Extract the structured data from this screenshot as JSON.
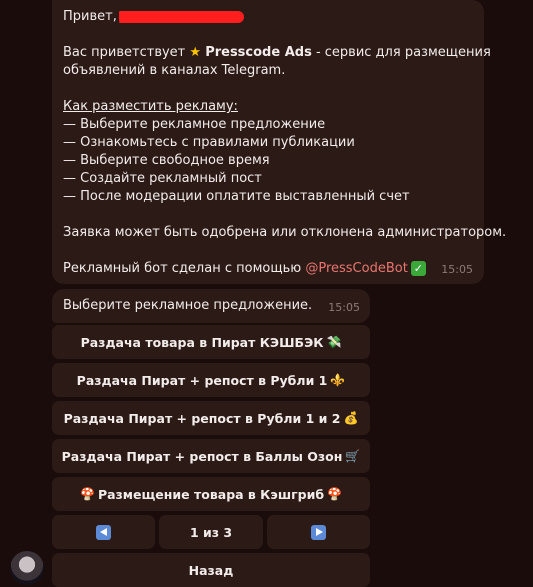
{
  "message1": {
    "greeting": "Привет,",
    "intro_prefix": "Вас приветствует",
    "intro_brand": "Presscode Ads",
    "intro_suffix": "- сервис для размещения",
    "intro_line2": "объявлений в каналах Telegram.",
    "howto_title": "Как разместить рекламу:",
    "steps": [
      "— Выберите рекламное предложение",
      "— Ознакомьтесь с правилами публикации",
      "— Выберите свободное время",
      "— Создайте рекламный пост",
      "— После модерации оплатите выставленный счет"
    ],
    "approval_note": "Заявка может быть одобрена или отклонена администратором.",
    "made_with": "Рекламный бот сделан с помощью",
    "mention": "@PressCodeBot",
    "time": "15:05"
  },
  "message2": {
    "text": "Выберите рекламное предложение.",
    "time": "15:05"
  },
  "keyboard": {
    "buttons": [
      {
        "label": "Раздача товара в Пират КЭШБЭК",
        "emoji": "💸"
      },
      {
        "label": "Раздача Пират + репост в Рубли 1",
        "emoji": "⚜️"
      },
      {
        "label": "Раздача Пират + репост в Рубли 1 и 2",
        "emoji": "💰"
      },
      {
        "label": "Раздача Пират + репост в Баллы Озон",
        "emoji": "🛒"
      },
      {
        "label": "Размещение товара в Кэшгриб",
        "emoji": "🍄"
      }
    ],
    "page_indicator": "1 из 3",
    "back_label": "Назад"
  },
  "icons": {
    "star": "star-icon",
    "check": "check-icon",
    "prev": "arrow-left-icon",
    "next": "arrow-right-icon",
    "avatar": "avatar"
  },
  "colors": {
    "background": "#1a0c0b",
    "bubble": "#2c1a17",
    "mention": "#e8766f",
    "redaction": "#ff1e1e",
    "nav_arrow": "#5c8ad6"
  }
}
